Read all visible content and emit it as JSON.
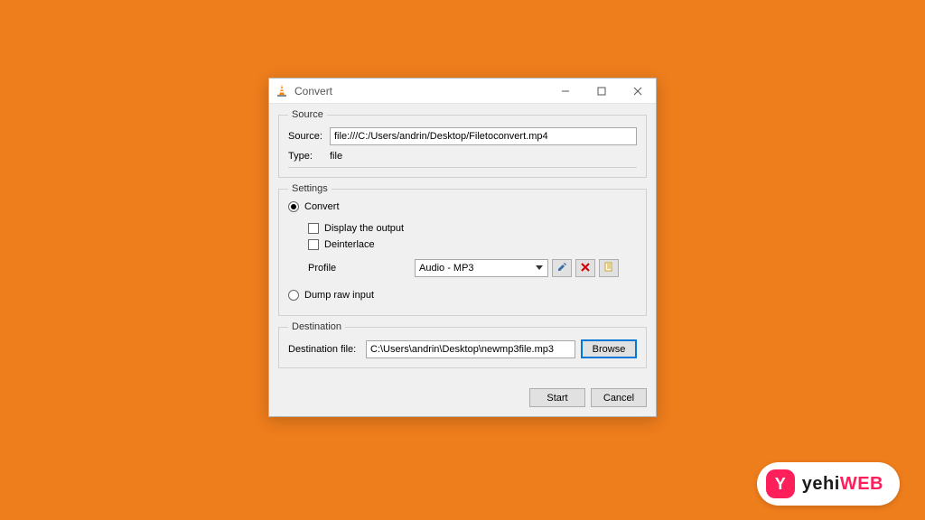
{
  "window": {
    "title": "Convert"
  },
  "source": {
    "legend": "Source",
    "source_label": "Source:",
    "source_value": "file:///C:/Users/andrin/Desktop/Filetoconvert.mp4",
    "type_label": "Type:",
    "type_value": "file"
  },
  "settings": {
    "legend": "Settings",
    "convert_label": "Convert",
    "display_output_label": "Display the output",
    "deinterlace_label": "Deinterlace",
    "profile_label": "Profile",
    "profile_value": "Audio - MP3",
    "dump_raw_label": "Dump raw input"
  },
  "destination": {
    "legend": "Destination",
    "dest_label": "Destination file:",
    "dest_value": "C:\\Users\\andrin\\Desktop\\newmp3file.mp3",
    "browse_label": "Browse"
  },
  "buttons": {
    "start": "Start",
    "cancel": "Cancel"
  },
  "badge": {
    "icon_letter": "Y",
    "text_a": "yehi",
    "text_b": "WEB"
  }
}
